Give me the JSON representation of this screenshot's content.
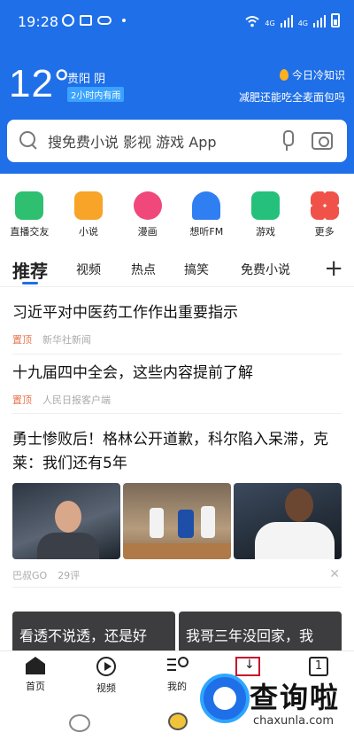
{
  "status_bar": {
    "time": "19:28",
    "network": "4G"
  },
  "weather": {
    "temperature": "12°",
    "city_condition": "贵阳 阴",
    "rain_tag": "2小时内有雨"
  },
  "knowledge": {
    "title": "今日冷知识",
    "subtitle": "减肥还能吃全麦面包吗"
  },
  "search": {
    "placeholder": "搜免费小说 影视 游戏 App"
  },
  "quick_apps": [
    {
      "label": "直播交友",
      "icon": "live-video-icon",
      "color": "#2fbf71"
    },
    {
      "label": "小说",
      "icon": "book-icon",
      "color": "#f7a428"
    },
    {
      "label": "漫画",
      "icon": "comic-icon",
      "color": "#f0487a"
    },
    {
      "label": "想听FM",
      "icon": "headphones-icon",
      "color": "#2f7ff2"
    },
    {
      "label": "游戏",
      "icon": "gamepad-icon",
      "color": "#25c07b"
    },
    {
      "label": "更多",
      "icon": "more-grid-icon",
      "color": "#f0524a"
    }
  ],
  "tabs": [
    {
      "label": "推荐",
      "active": true
    },
    {
      "label": "视频",
      "active": false
    },
    {
      "label": "热点",
      "active": false
    },
    {
      "label": "搞笑",
      "active": false
    },
    {
      "label": "免费小说",
      "active": false
    }
  ],
  "tab_add": "+",
  "news": [
    {
      "title": "习近平对中医药工作作出重要指示",
      "tag": "置顶",
      "source": "新华社新闻"
    },
    {
      "title": "十九届四中全会，这些内容提前了解",
      "tag": "置顶",
      "source": "人民日报客户端"
    },
    {
      "title": "勇士惨败后！格林公开道歉，科尔陷入呆滞，克莱：我们还有5年",
      "source": "巴叔GO",
      "comments": "29评"
    }
  ],
  "video_cards": [
    {
      "title": "看透不说透，还是好"
    },
    {
      "title": "我哥三年没回家，我"
    }
  ],
  "bottom_nav": [
    {
      "label": "首页",
      "icon": "home-icon"
    },
    {
      "label": "视频",
      "icon": "play-icon"
    },
    {
      "label": "我的",
      "icon": "profile-icon"
    },
    {
      "label": "",
      "icon": "download-icon"
    },
    {
      "label": "",
      "icon": "tabs-count-icon",
      "count": "1"
    }
  ],
  "watermark": {
    "brand": "查询啦",
    "url": "chaxunla.com"
  }
}
